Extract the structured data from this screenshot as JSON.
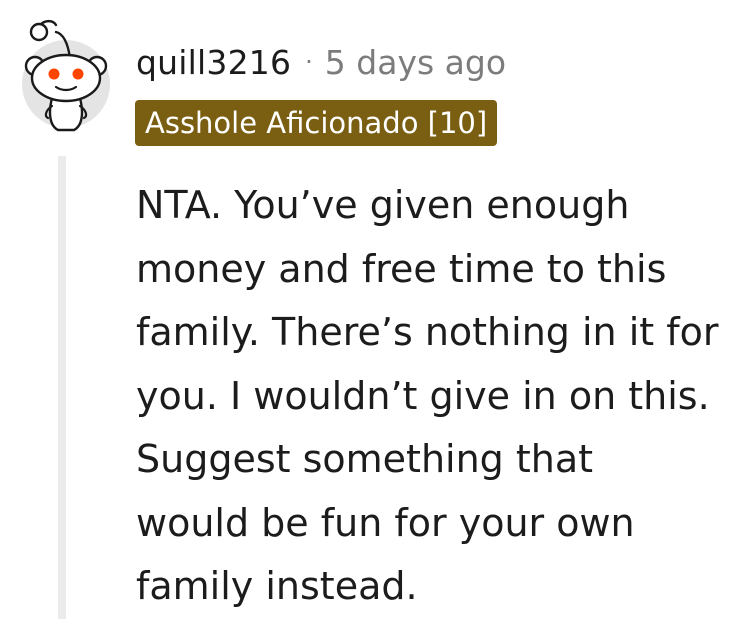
{
  "comment": {
    "username": "quill3216",
    "separator": "·",
    "timestamp": "5 days ago",
    "flair": "Asshole Aficionado [10]",
    "body_lines": [
      "NTA. You’ve given enough",
      "money and free time to this",
      "family. There’s nothing in it for",
      "you. I wouldn’t give in on this.",
      "Suggest something that",
      "would be fun for your own",
      "family instead."
    ]
  },
  "colors": {
    "flair_background": "#7a5e12",
    "flair_text": "#ffffff",
    "meta_muted": "#7c7c7c",
    "thread_line": "#ebebeb",
    "avatar_accent": "#ff4500"
  },
  "icons": {
    "avatar": "reddit-snoo-avatar-icon"
  }
}
